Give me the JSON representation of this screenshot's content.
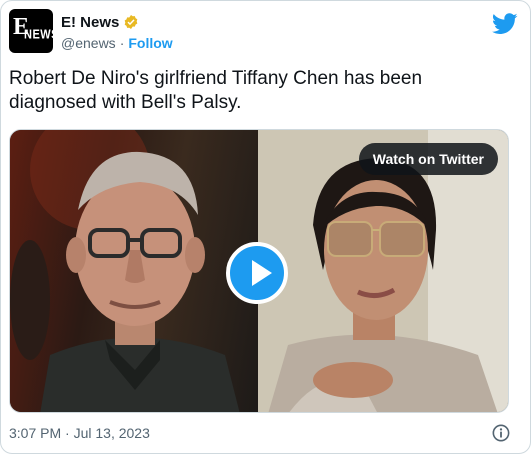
{
  "account": {
    "display_name": "E! News",
    "handle": "@enews",
    "separator": "·",
    "follow_label": "Follow",
    "avatar_logo_letter": "E",
    "avatar_logo_word": "NEWS",
    "verified_color": "#e8b923",
    "brand_color": "#1d9bf0"
  },
  "tweet": {
    "text": "Robert De Niro's girlfriend Tiffany Chen has been\ndiagnosed with Bell's Palsy.",
    "timestamp": "3:07 PM · Jul 13, 2023"
  },
  "media": {
    "watch_label": "Watch on Twitter",
    "play_icon": "play-icon"
  },
  "icons": {
    "brand": "twitter-bird-icon",
    "info": "info-icon",
    "verified": "verified-badge-icon"
  }
}
